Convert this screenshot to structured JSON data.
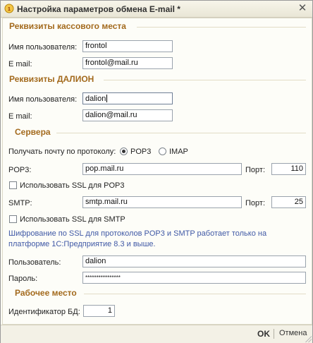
{
  "window": {
    "title": "Настройка параметров обмена E-mail *",
    "close_glyph": "✕"
  },
  "sections": {
    "cash": "Реквизиты кассового места",
    "dalion": "Реквизиты ДАЛИОН",
    "servers": "Сервера",
    "workplace": "Рабочее место"
  },
  "cash": {
    "user_label": "Имя пользователя:",
    "user_value": "frontol",
    "email_label": "E mail:",
    "email_value": "frontol@mail.ru"
  },
  "dalion": {
    "user_label": "Имя пользователя:",
    "user_value": "dalion",
    "email_label": "E mail:",
    "email_value": "dalion@mail.ru"
  },
  "servers": {
    "protocol_label": "Получать почту по протоколу:",
    "protocol_options": [
      "POP3",
      "IMAP"
    ],
    "protocol_selected": "POP3",
    "pop3_label": "POP3:",
    "pop3_value": "pop.mail.ru",
    "port_label": "Порт:",
    "pop3_port": "110",
    "pop3_ssl_label": "Использовать SSL для POP3",
    "pop3_ssl_checked": false,
    "smtp_label": "SMTP:",
    "smtp_value": "smtp.mail.ru",
    "smtp_port": "25",
    "smtp_ssl_label": "Использовать SSL для SMTP",
    "smtp_ssl_checked": false,
    "info_text": "Шифрование по SSL для протоколов POP3 и SMTP работает только на платформе 1С:Предприятие 8.3 и выше.",
    "login_label": "Пользователь:",
    "login_value": "dalion",
    "password_label": "Пароль:",
    "password_value": "****************"
  },
  "workplace": {
    "db_id_label": "Идентификатор БД:",
    "db_id_value": "1"
  },
  "footer": {
    "ok_label": "OK",
    "cancel_label": "Отмена"
  },
  "colors": {
    "section_title": "#a36a1d",
    "info_text": "#4059a6",
    "field_border": "#9aa3ad"
  },
  "icons": {
    "app": "1c-app-icon",
    "close": "close-icon"
  }
}
